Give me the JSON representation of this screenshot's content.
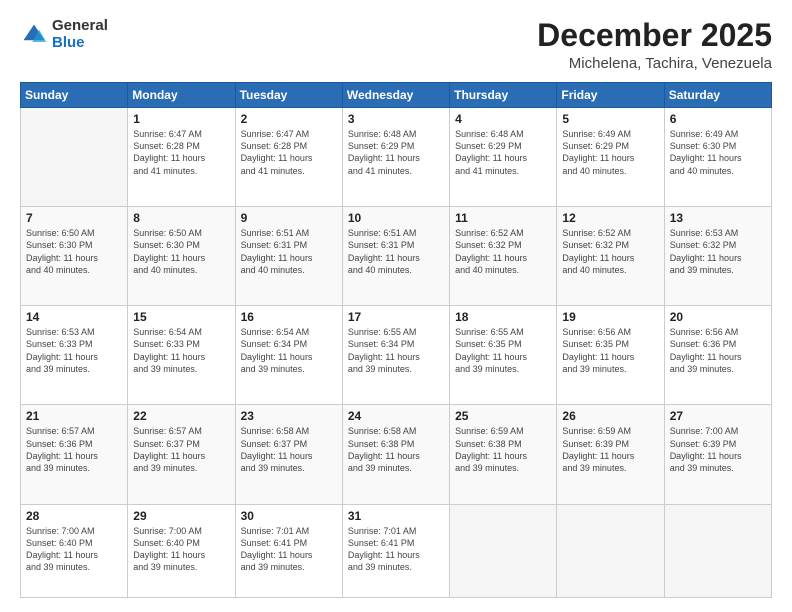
{
  "logo": {
    "general": "General",
    "blue": "Blue"
  },
  "title": "December 2025",
  "subtitle": "Michelena, Tachira, Venezuela",
  "weekdays": [
    "Sunday",
    "Monday",
    "Tuesday",
    "Wednesday",
    "Thursday",
    "Friday",
    "Saturday"
  ],
  "weeks": [
    [
      {
        "day": "",
        "info": ""
      },
      {
        "day": "1",
        "info": "Sunrise: 6:47 AM\nSunset: 6:28 PM\nDaylight: 11 hours\nand 41 minutes."
      },
      {
        "day": "2",
        "info": "Sunrise: 6:47 AM\nSunset: 6:28 PM\nDaylight: 11 hours\nand 41 minutes."
      },
      {
        "day": "3",
        "info": "Sunrise: 6:48 AM\nSunset: 6:29 PM\nDaylight: 11 hours\nand 41 minutes."
      },
      {
        "day": "4",
        "info": "Sunrise: 6:48 AM\nSunset: 6:29 PM\nDaylight: 11 hours\nand 41 minutes."
      },
      {
        "day": "5",
        "info": "Sunrise: 6:49 AM\nSunset: 6:29 PM\nDaylight: 11 hours\nand 40 minutes."
      },
      {
        "day": "6",
        "info": "Sunrise: 6:49 AM\nSunset: 6:30 PM\nDaylight: 11 hours\nand 40 minutes."
      }
    ],
    [
      {
        "day": "7",
        "info": "Sunrise: 6:50 AM\nSunset: 6:30 PM\nDaylight: 11 hours\nand 40 minutes."
      },
      {
        "day": "8",
        "info": "Sunrise: 6:50 AM\nSunset: 6:30 PM\nDaylight: 11 hours\nand 40 minutes."
      },
      {
        "day": "9",
        "info": "Sunrise: 6:51 AM\nSunset: 6:31 PM\nDaylight: 11 hours\nand 40 minutes."
      },
      {
        "day": "10",
        "info": "Sunrise: 6:51 AM\nSunset: 6:31 PM\nDaylight: 11 hours\nand 40 minutes."
      },
      {
        "day": "11",
        "info": "Sunrise: 6:52 AM\nSunset: 6:32 PM\nDaylight: 11 hours\nand 40 minutes."
      },
      {
        "day": "12",
        "info": "Sunrise: 6:52 AM\nSunset: 6:32 PM\nDaylight: 11 hours\nand 40 minutes."
      },
      {
        "day": "13",
        "info": "Sunrise: 6:53 AM\nSunset: 6:32 PM\nDaylight: 11 hours\nand 39 minutes."
      }
    ],
    [
      {
        "day": "14",
        "info": "Sunrise: 6:53 AM\nSunset: 6:33 PM\nDaylight: 11 hours\nand 39 minutes."
      },
      {
        "day": "15",
        "info": "Sunrise: 6:54 AM\nSunset: 6:33 PM\nDaylight: 11 hours\nand 39 minutes."
      },
      {
        "day": "16",
        "info": "Sunrise: 6:54 AM\nSunset: 6:34 PM\nDaylight: 11 hours\nand 39 minutes."
      },
      {
        "day": "17",
        "info": "Sunrise: 6:55 AM\nSunset: 6:34 PM\nDaylight: 11 hours\nand 39 minutes."
      },
      {
        "day": "18",
        "info": "Sunrise: 6:55 AM\nSunset: 6:35 PM\nDaylight: 11 hours\nand 39 minutes."
      },
      {
        "day": "19",
        "info": "Sunrise: 6:56 AM\nSunset: 6:35 PM\nDaylight: 11 hours\nand 39 minutes."
      },
      {
        "day": "20",
        "info": "Sunrise: 6:56 AM\nSunset: 6:36 PM\nDaylight: 11 hours\nand 39 minutes."
      }
    ],
    [
      {
        "day": "21",
        "info": "Sunrise: 6:57 AM\nSunset: 6:36 PM\nDaylight: 11 hours\nand 39 minutes."
      },
      {
        "day": "22",
        "info": "Sunrise: 6:57 AM\nSunset: 6:37 PM\nDaylight: 11 hours\nand 39 minutes."
      },
      {
        "day": "23",
        "info": "Sunrise: 6:58 AM\nSunset: 6:37 PM\nDaylight: 11 hours\nand 39 minutes."
      },
      {
        "day": "24",
        "info": "Sunrise: 6:58 AM\nSunset: 6:38 PM\nDaylight: 11 hours\nand 39 minutes."
      },
      {
        "day": "25",
        "info": "Sunrise: 6:59 AM\nSunset: 6:38 PM\nDaylight: 11 hours\nand 39 minutes."
      },
      {
        "day": "26",
        "info": "Sunrise: 6:59 AM\nSunset: 6:39 PM\nDaylight: 11 hours\nand 39 minutes."
      },
      {
        "day": "27",
        "info": "Sunrise: 7:00 AM\nSunset: 6:39 PM\nDaylight: 11 hours\nand 39 minutes."
      }
    ],
    [
      {
        "day": "28",
        "info": "Sunrise: 7:00 AM\nSunset: 6:40 PM\nDaylight: 11 hours\nand 39 minutes."
      },
      {
        "day": "29",
        "info": "Sunrise: 7:00 AM\nSunset: 6:40 PM\nDaylight: 11 hours\nand 39 minutes."
      },
      {
        "day": "30",
        "info": "Sunrise: 7:01 AM\nSunset: 6:41 PM\nDaylight: 11 hours\nand 39 minutes."
      },
      {
        "day": "31",
        "info": "Sunrise: 7:01 AM\nSunset: 6:41 PM\nDaylight: 11 hours\nand 39 minutes."
      },
      {
        "day": "",
        "info": ""
      },
      {
        "day": "",
        "info": ""
      },
      {
        "day": "",
        "info": ""
      }
    ]
  ]
}
